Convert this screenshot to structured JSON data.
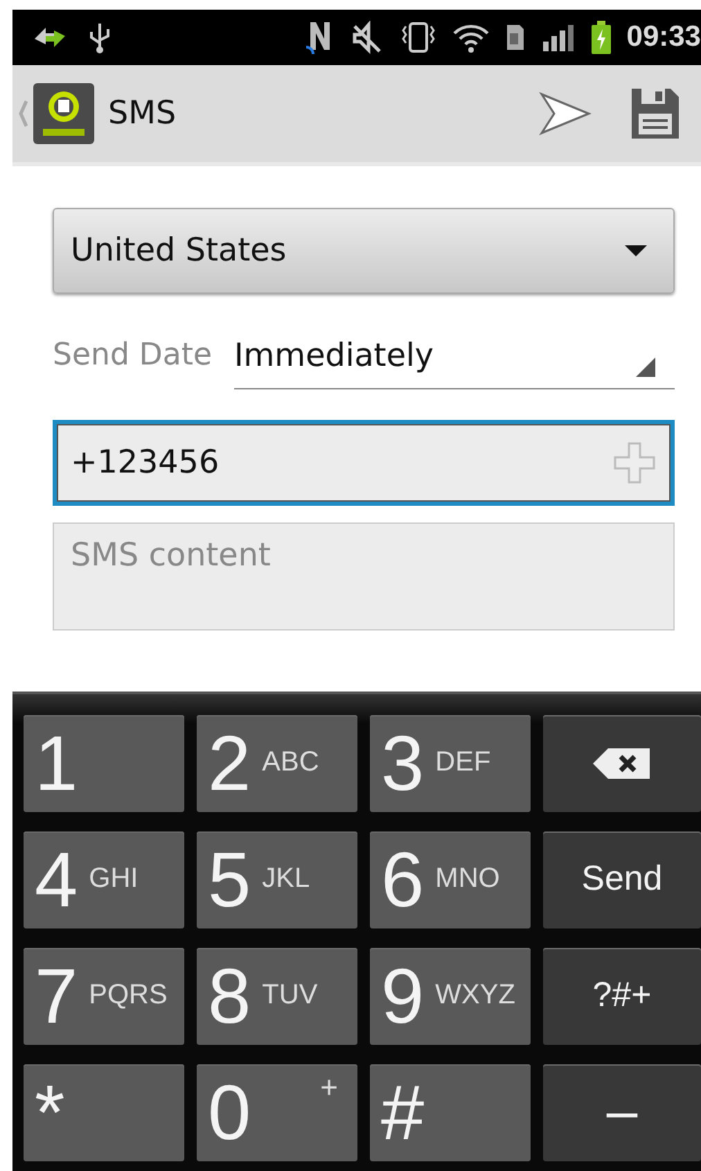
{
  "status_bar": {
    "time": "09:33"
  },
  "action_bar": {
    "title": "SMS"
  },
  "country": {
    "value": "United States"
  },
  "send_date": {
    "label": "Send Date",
    "value": "Immediately"
  },
  "phone": {
    "value": "+123456"
  },
  "content": {
    "placeholder": "SMS content"
  },
  "keypad": [
    {
      "kind": "digit",
      "main": "1"
    },
    {
      "kind": "digit",
      "main": "2",
      "sub": "ABC"
    },
    {
      "kind": "digit",
      "main": "3",
      "sub": "DEF"
    },
    {
      "kind": "backspace"
    },
    {
      "kind": "digit",
      "main": "4",
      "sub": "GHI"
    },
    {
      "kind": "digit",
      "main": "5",
      "sub": "JKL"
    },
    {
      "kind": "digit",
      "main": "6",
      "sub": "MNO"
    },
    {
      "kind": "action",
      "label": "Send"
    },
    {
      "kind": "digit",
      "main": "7",
      "sub": "PQRS"
    },
    {
      "kind": "digit",
      "main": "8",
      "sub": "TUV"
    },
    {
      "kind": "digit",
      "main": "9",
      "sub": "WXYZ"
    },
    {
      "kind": "action",
      "label": "?#+"
    },
    {
      "kind": "digit",
      "main": "*"
    },
    {
      "kind": "digit",
      "main": "0",
      "corner": "+"
    },
    {
      "kind": "digit",
      "main": "#"
    },
    {
      "kind": "action",
      "label": "–"
    }
  ]
}
